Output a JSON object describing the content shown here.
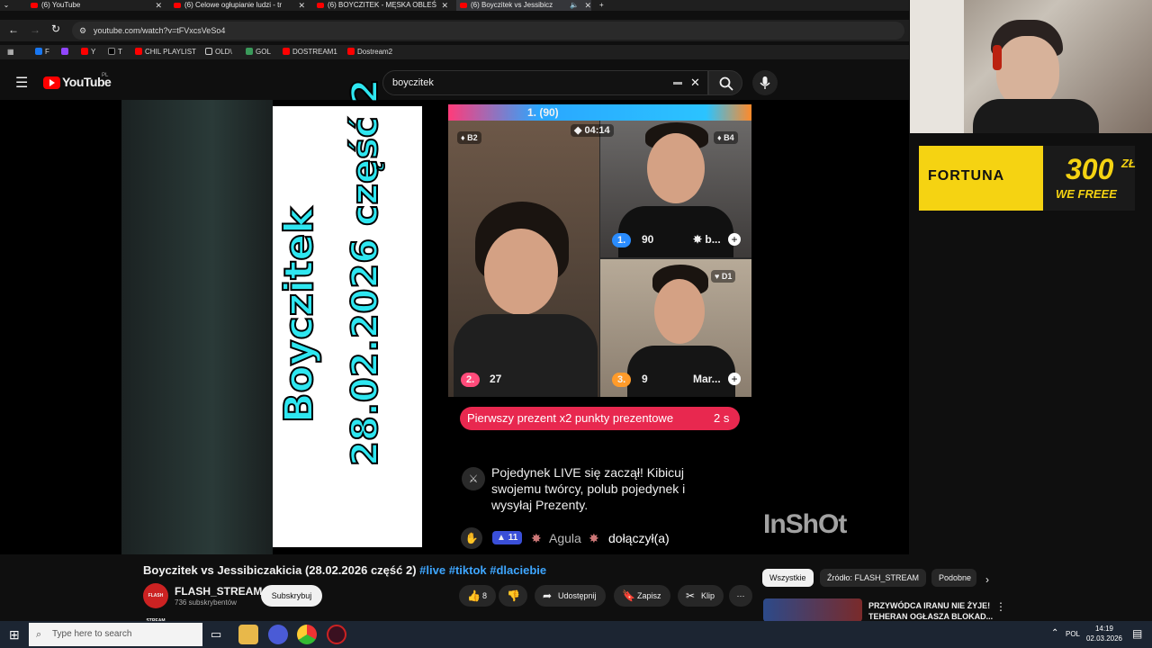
{
  "browser": {
    "tabs": [
      {
        "label": "(6) YouTube",
        "active": false
      },
      {
        "label": "(6) Celowe ogłupianie ludzi - tr",
        "active": false
      },
      {
        "label": "(6) BOYCZITEK - MĘSKA OBLEŚ",
        "active": false
      },
      {
        "label": "(6) Boyczitek vs Jessibicz",
        "active": true
      }
    ],
    "url": "youtube.com/watch?v=tFVxcsVeSo4",
    "bookmarks": [
      "F",
      "",
      "Y",
      "T",
      "CHIL PLAYLIST",
      "OLD\\",
      "GOL",
      "DOSTREAM1",
      "Dostream2"
    ]
  },
  "youtube": {
    "logo_text": "YouTube",
    "logo_region": "PL",
    "search_value": "boyczitek"
  },
  "video": {
    "title_card_line1": "Boyczitek",
    "title_card_line2": "28.02.2026 część 2",
    "live": {
      "top_rank": "1. (90)",
      "timer": "04:14",
      "badge_tl": "B2",
      "badge_tr": "B4",
      "badge_br": "D1",
      "rank1_label": "1.",
      "rank1_score": "90",
      "rank1_name": "b...",
      "rank2_label": "2.",
      "rank2_score": "27",
      "rank3_label": "3.",
      "rank3_score": "9",
      "rank3_name": "Mar...",
      "prompt_text": "Pierwszy prezent x2 punkty prezentowe",
      "prompt_timer": "2 s",
      "chat_message": "Pojedynek LIVE się zaczął! Kibicuj swojemu twórcy, polub pojedynek i wysyłaj Prezenty.",
      "join_level": "11",
      "join_user": "Agula",
      "join_text": "dołączył(a)"
    },
    "watermark": "InShOt"
  },
  "below_player": {
    "title_main": "Boyczitek vs Jessibiczakicia (28.02.2026 część 2)",
    "hashtags": [
      "#live",
      "#tiktok",
      "#dlaciebie"
    ],
    "channel_name": "FLASH_STREAM",
    "channel_avatar_text": "FLASH STREAM",
    "subscribers": "736 subskrybentów",
    "subscribe_label": "Subskrybuj",
    "like_count": "8",
    "share_label": "Udostępnij",
    "save_label": "Zapisz",
    "clip_label": "Klip",
    "chips": [
      "Wszystkie",
      "Źródło: FLASH_STREAM",
      "Podobne"
    ],
    "rec_title": "PRZYWÓDCA IRANU NIE ŻYJE! TEHERAN OGŁASZA BLOKAD..."
  },
  "ad": {
    "brand": "FORTUNA",
    "amount": "300",
    "currency": "ZŁ",
    "slogan": "WE FREEE"
  },
  "taskbar": {
    "search_placeholder": "Type here to search",
    "language": "POL",
    "time": "14:19",
    "date": "02.03.2026"
  }
}
